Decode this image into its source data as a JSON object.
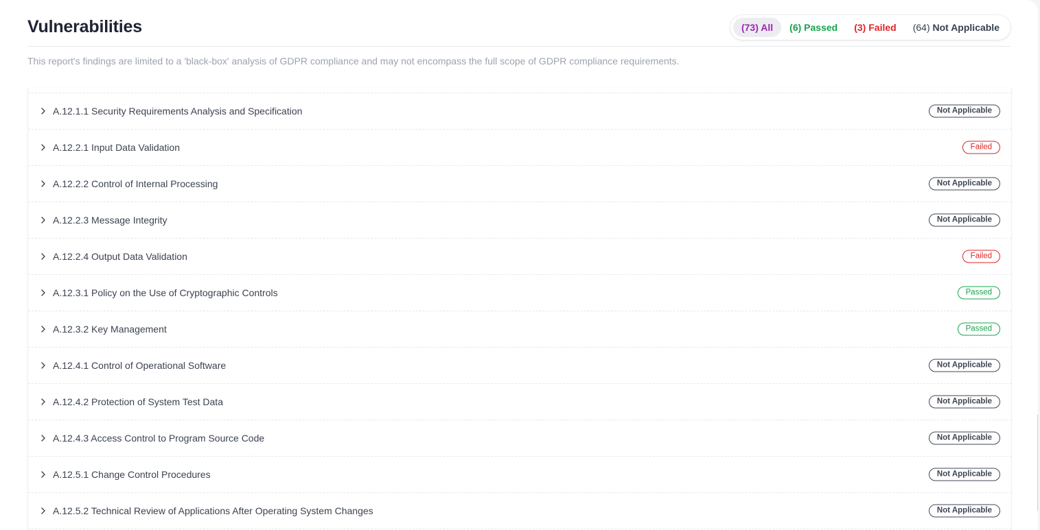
{
  "header": {
    "title": "Vulnerabilities"
  },
  "filters": [
    {
      "count": "(73)",
      "label": "All",
      "kind": "all",
      "active": true
    },
    {
      "count": "(6)",
      "label": "Passed",
      "kind": "pass",
      "active": false
    },
    {
      "count": "(3)",
      "label": "Failed",
      "kind": "fail",
      "active": false
    },
    {
      "count": "(64)",
      "label": "Not Applicable",
      "kind": "na",
      "active": false
    }
  ],
  "disclaimer": "This report's findings are limited to a 'black-box' analysis of GDPR compliance and may not encompass the full scope of GDPR compliance requirements.",
  "rows": [
    {
      "label": "A.12.1.1 Security Requirements Analysis and Specification",
      "status": "Not Applicable",
      "status_kind": "na"
    },
    {
      "label": "A.12.2.1 Input Data Validation",
      "status": "Failed",
      "status_kind": "failed"
    },
    {
      "label": "A.12.2.2 Control of Internal Processing",
      "status": "Not Applicable",
      "status_kind": "na"
    },
    {
      "label": "A.12.2.3 Message Integrity",
      "status": "Not Applicable",
      "status_kind": "na"
    },
    {
      "label": "A.12.2.4 Output Data Validation",
      "status": "Failed",
      "status_kind": "failed"
    },
    {
      "label": "A.12.3.1 Policy on the Use of Cryptographic Controls",
      "status": "Passed",
      "status_kind": "passed"
    },
    {
      "label": "A.12.3.2 Key Management",
      "status": "Passed",
      "status_kind": "passed"
    },
    {
      "label": "A.12.4.1 Control of Operational Software",
      "status": "Not Applicable",
      "status_kind": "na"
    },
    {
      "label": "A.12.4.2 Protection of System Test Data",
      "status": "Not Applicable",
      "status_kind": "na"
    },
    {
      "label": "A.12.4.3 Access Control to Program Source Code",
      "status": "Not Applicable",
      "status_kind": "na"
    },
    {
      "label": "A.12.5.1 Change Control Procedures",
      "status": "Not Applicable",
      "status_kind": "na"
    },
    {
      "label": "A.12.5.2 Technical Review of Applications After Operating System Changes",
      "status": "Not Applicable",
      "status_kind": "na"
    }
  ],
  "colors": {
    "all": "#9c27b0",
    "passed": "#16a34a",
    "failed": "#dc2626",
    "not_applicable": "#3f4654"
  },
  "icons": {
    "row_toggle": "chevron-right-icon"
  }
}
